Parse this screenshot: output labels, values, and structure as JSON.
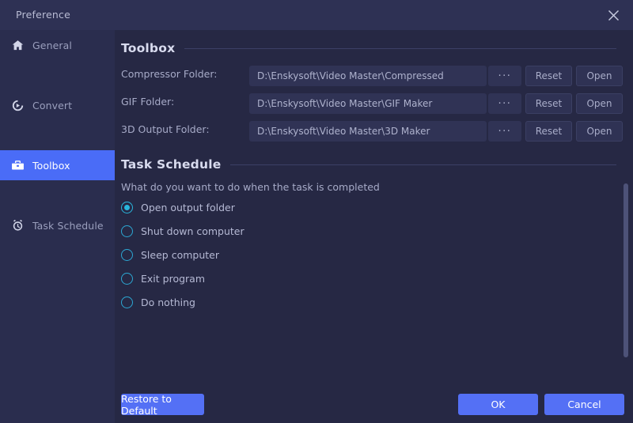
{
  "window": {
    "title": "Preference",
    "close_icon": "close-icon"
  },
  "sidebar": {
    "items": [
      {
        "label": "General",
        "icon": "home-icon",
        "active": false
      },
      {
        "label": "Convert",
        "icon": "convert-icon",
        "active": false
      },
      {
        "label": "Toolbox",
        "icon": "toolbox-icon",
        "active": true
      },
      {
        "label": "Task Schedule",
        "icon": "alarm-clock-icon",
        "active": false
      }
    ]
  },
  "toolbox": {
    "section_title": "Toolbox",
    "rows": [
      {
        "label": "Compressor Folder:",
        "path": "D:\\Enskysoft\\Video Master\\Compressed",
        "browse_label": "···",
        "reset_label": "Reset",
        "open_label": "Open"
      },
      {
        "label": "GIF Folder:",
        "path": "D:\\Enskysoft\\Video Master\\GIF Maker",
        "browse_label": "···",
        "reset_label": "Reset",
        "open_label": "Open"
      },
      {
        "label": "3D Output Folder:",
        "path": "D:\\Enskysoft\\Video Master\\3D Maker",
        "browse_label": "···",
        "reset_label": "Reset",
        "open_label": "Open"
      }
    ]
  },
  "task_schedule": {
    "section_title": "Task Schedule",
    "subtitle": "What do you want to do when the task is completed",
    "options": [
      {
        "label": "Open output folder",
        "checked": true
      },
      {
        "label": "Shut down computer",
        "checked": false
      },
      {
        "label": "Sleep computer",
        "checked": false
      },
      {
        "label": "Exit program",
        "checked": false
      },
      {
        "label": "Do nothing",
        "checked": false
      }
    ]
  },
  "footer": {
    "restore_label": "Restore to Default",
    "ok_label": "OK",
    "cancel_label": "Cancel"
  },
  "colors": {
    "accent_blue": "#4A6CF7",
    "button_blue": "#5470F5",
    "radio_cyan": "#29B6DC",
    "titlebar_bg": "#2E3154",
    "sidebar_bg": "#2A2D4E",
    "main_bg": "#262844",
    "field_bg": "#303355"
  }
}
